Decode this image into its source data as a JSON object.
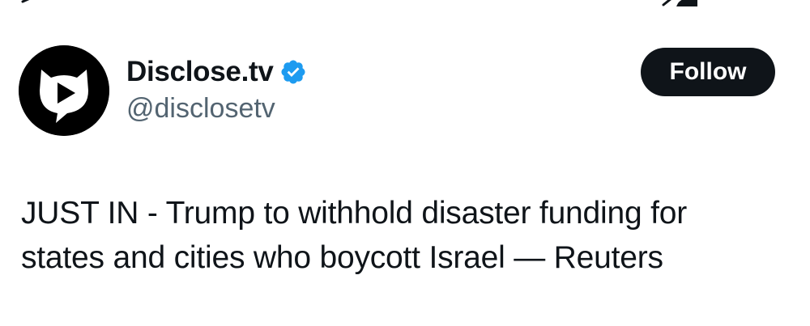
{
  "account": {
    "display_name": "Disclose.tv",
    "handle": "@disclosetv",
    "verified": true,
    "verified_color": "#1d9bf0"
  },
  "follow_button": {
    "label": "Follow",
    "background": "#0f1419",
    "text_color": "#ffffff"
  },
  "tweet": {
    "lines": [
      "JUST IN - Trump to withhold disaster funding for",
      "states and cities who boycott Israel — Reuters"
    ]
  },
  "icons": {
    "avatar": "disclose-tv-logo-icon",
    "verified": "verified-badge-icon",
    "top_left": "back-arrow-icon",
    "top_right": "grok-icon"
  }
}
